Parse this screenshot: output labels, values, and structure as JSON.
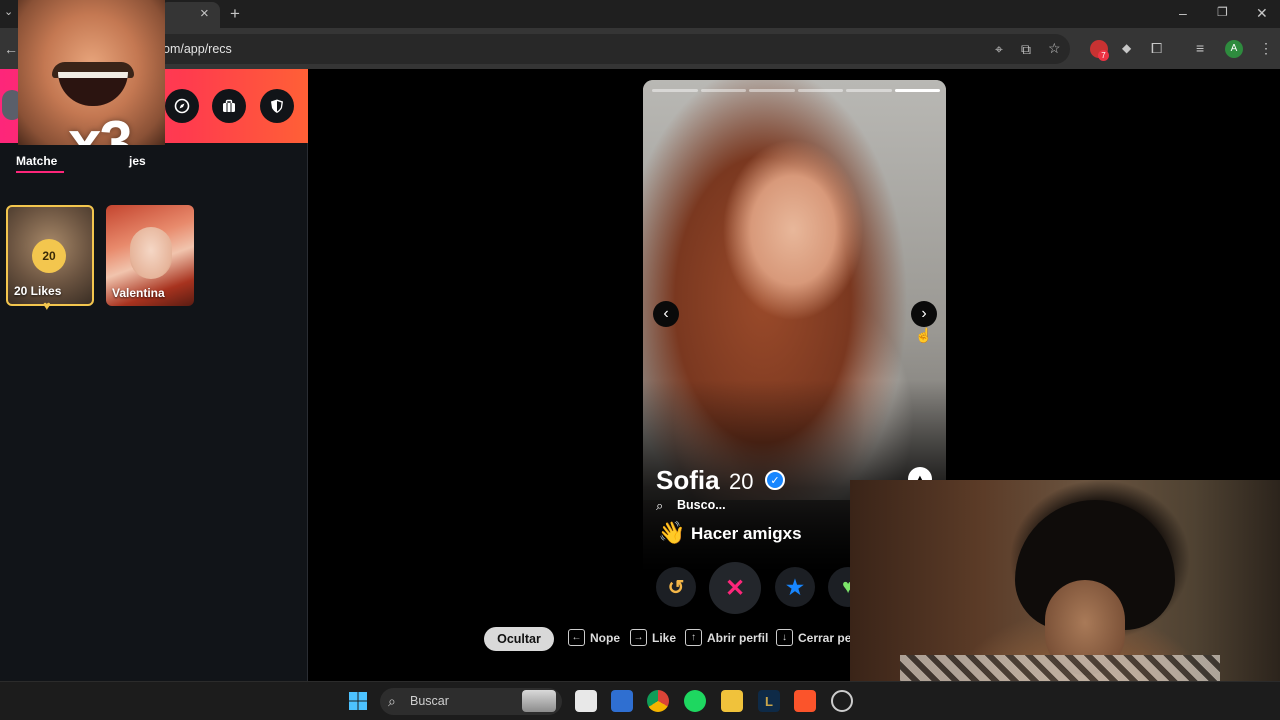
{
  "browser": {
    "url": "om/app/recs",
    "tab_close": "×",
    "new_tab": "+",
    "window_controls": {
      "minimize": "–",
      "restore": "❐",
      "close": "✕"
    },
    "profile_initial": "A",
    "extension_badge": "7"
  },
  "sidebar": {
    "header_icons": [
      "explore-icon",
      "briefcase-icon",
      "shield-icon"
    ],
    "tabs": [
      {
        "label": "Matche",
        "active": true
      },
      {
        "label": "jes",
        "active": false
      }
    ],
    "cards": [
      {
        "badge": "20",
        "label": "20 Likes"
      },
      {
        "label": "Valentina"
      }
    ]
  },
  "meme": {
    "text": "x3"
  },
  "profile": {
    "name": "Sofia",
    "age": "20",
    "looking_for": "Busco...",
    "goal_emoji": "👋",
    "goal": "Hacer amigxs",
    "photo_segments": 6,
    "active_segment": 5
  },
  "actions": {
    "rewind": "↺",
    "nope": "✕",
    "super_like": "★",
    "like": "♥"
  },
  "shortcuts": {
    "hide": "Ocultar",
    "nope": "Nope",
    "like": "Like",
    "open_profile": "Abrir perfil",
    "close_profile": "Cerrar per"
  },
  "taskbar": {
    "search_placeholder": "Buscar"
  },
  "colors": {
    "brand_gradient_start": "#fd267a",
    "brand_gradient_end": "#ff6036",
    "likes_gold": "#f3c64e",
    "rewind": "#f5b748",
    "nope": "#fd267a",
    "super_like": "#1786ff",
    "like": "#7ce56b",
    "verified": "#1786ff"
  }
}
